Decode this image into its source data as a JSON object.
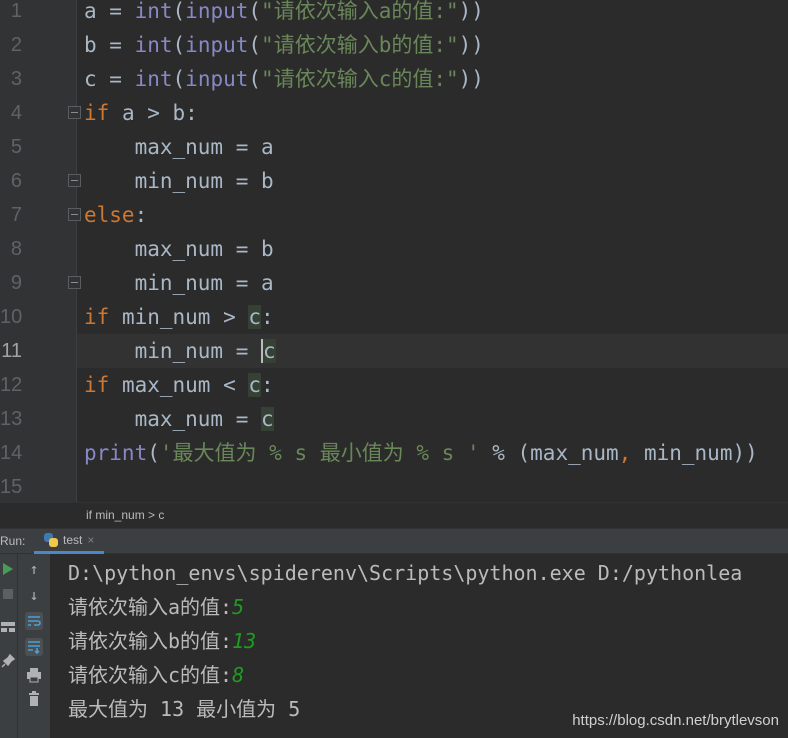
{
  "editor": {
    "line_numbers": [
      "1",
      "2",
      "3",
      "4",
      "5",
      "6",
      "7",
      "8",
      "9",
      "10",
      "11",
      "12",
      "13",
      "14",
      "15"
    ],
    "lines": [
      [
        "a = ",
        "int",
        "(",
        "input",
        "(",
        "\"请依次输入a的值:\"",
        "))"
      ],
      [
        "b = ",
        "int",
        "(",
        "input",
        "(",
        "\"请依次输入b的值:\"",
        "))"
      ],
      [
        "c = ",
        "int",
        "(",
        "input",
        "(",
        "\"请依次输入c的值:\"",
        "))"
      ],
      [
        "if",
        " a > b:"
      ],
      [
        "    max_num = a"
      ],
      [
        "    min_num = b"
      ],
      [
        "else",
        ":"
      ],
      [
        "    max_num = b"
      ],
      [
        "    min_num = a"
      ],
      [
        "if",
        " min_num > ",
        "c",
        ":"
      ],
      [
        "    min_num = ",
        "c"
      ],
      [
        "if",
        " max_num < ",
        "c",
        ":"
      ],
      [
        "    max_num = ",
        "c"
      ],
      [
        "print",
        "(",
        "'最大值为 % s 最小值为 % s '",
        " % (max_num",
        ",",
        " min_num))"
      ]
    ]
  },
  "breadcrumb": "if min_num > c",
  "run_panel": {
    "label": "Run:",
    "tab_label": "test",
    "tab_close": "×",
    "console_lines": [
      {
        "text": "D:\\python_envs\\spiderenv\\Scripts\\python.exe D:/pythonlea",
        "input": ""
      },
      {
        "text": "请依次输入a的值:",
        "input": "5"
      },
      {
        "text": "请依次输入b的值:",
        "input": "13"
      },
      {
        "text": "请依次输入c的值:",
        "input": "8"
      },
      {
        "text": "最大值为 13 最小值为 5",
        "input": ""
      }
    ]
  },
  "watermark": "https://blog.csdn.net/brytlevson",
  "colors": {
    "keyword": "#cc7832",
    "builtin": "#8888c6",
    "string": "#6a8759",
    "user_input": "#1f9b1f",
    "background": "#2b2b2b"
  }
}
